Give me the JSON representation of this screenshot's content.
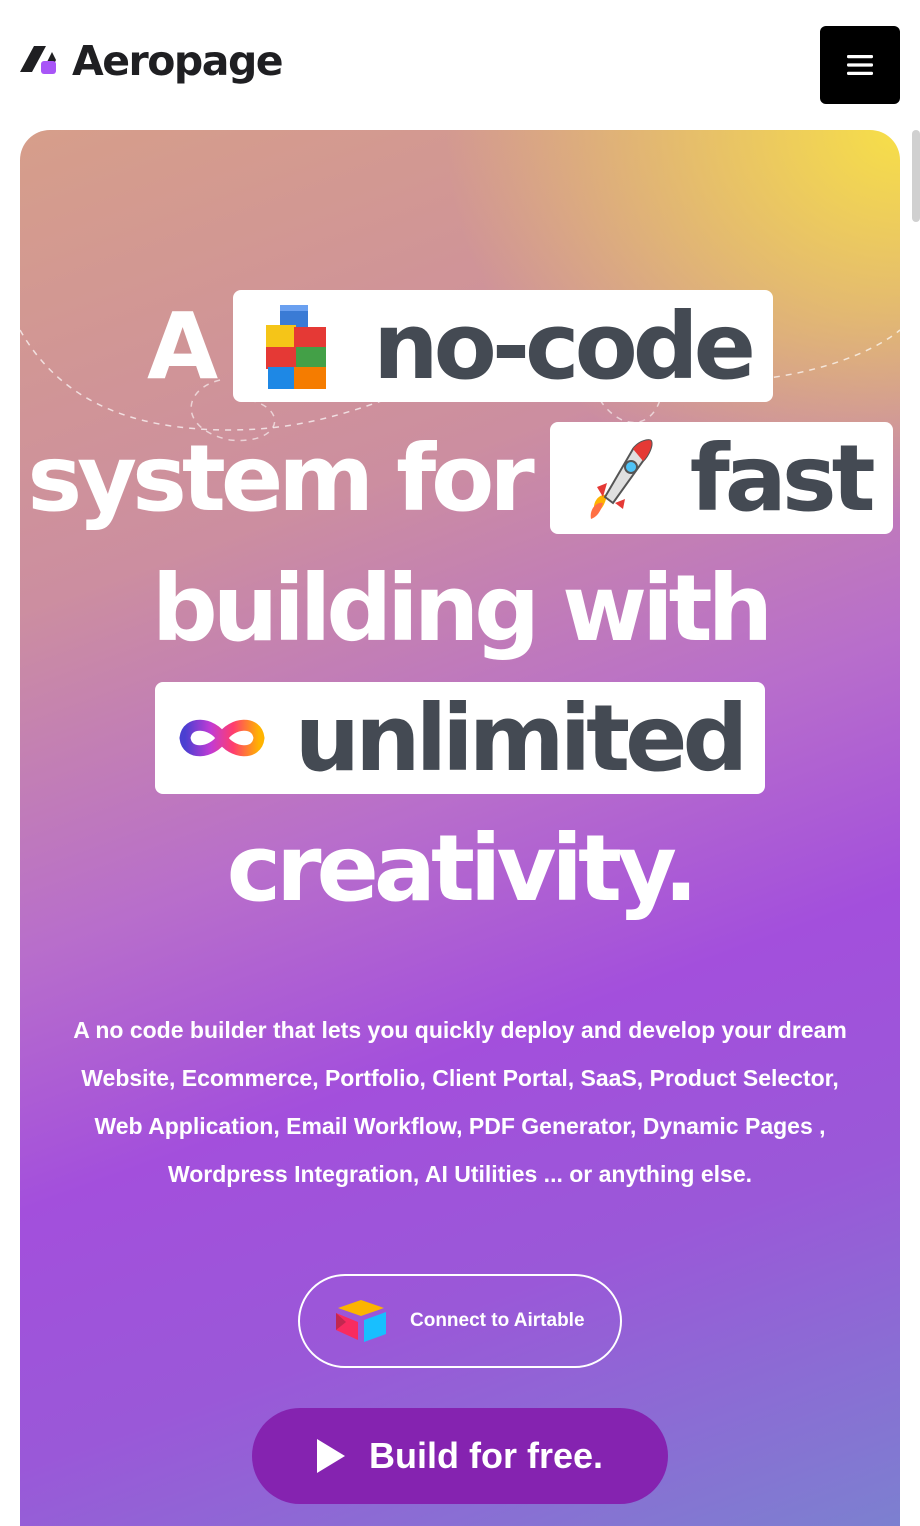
{
  "header": {
    "logo_text": "Aeropage",
    "menu_icon": "hamburger-menu-icon"
  },
  "hero": {
    "headline": {
      "word_a": "A",
      "pill_1": "no-code",
      "pill_1_icon": "building-blocks-icon",
      "line_2_text": "system for",
      "pill_2": "fast",
      "pill_2_icon": "rocket-icon",
      "line_3_text": "building with",
      "pill_3": "unlimited",
      "pill_3_icon": "infinity-icon",
      "line_5_text": "creativity."
    },
    "subtext": "A no code builder that lets you quickly deploy and develop your dream Website, Ecommerce, Portfolio, Client Portal, SaaS, Product Selector, Web Application, Email Workflow, PDF Generator, Dynamic Pages , Wordpress Integration, AI Utilities ... or anything else.",
    "connect_button": {
      "label": "Connect to Airtable",
      "icon": "airtable-logo-icon"
    },
    "build_button": {
      "label": "Build for free.",
      "icon": "play-icon"
    }
  },
  "colors": {
    "brand_purple": "#8523b0",
    "logo_accent": "#a855f7",
    "pill_text": "#444a53",
    "gradient_yellow": "#f7df48",
    "gradient_purple": "#a34fdc"
  }
}
